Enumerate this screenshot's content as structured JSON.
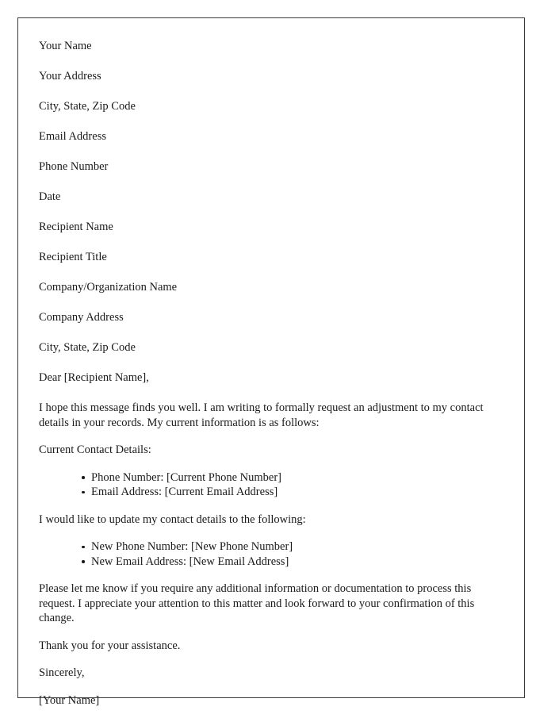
{
  "document": {
    "type": "formal-letter",
    "sender_block": [
      "Your Name",
      "Your Address",
      "City, State, Zip Code",
      "Email Address",
      "Phone Number"
    ],
    "date_line": "Date",
    "recipient_block": [
      "Recipient Name",
      "Recipient Title",
      "Company/Organization Name",
      "Company Address",
      "City, State, Zip Code"
    ],
    "salutation": "Dear [Recipient Name],",
    "opening_paragraph": "I hope this message finds you well. I am writing to formally request an adjustment to my contact details in your records. My current information is as follows:",
    "current_details_heading": "Current Contact Details:",
    "current_details_items": [
      "Phone Number: [Current Phone Number]",
      "Email Address: [Current Email Address]"
    ],
    "update_intro": "I would like to update my contact details to the following:",
    "new_details_items": [
      "New Phone Number: [New Phone Number]",
      "New Email Address: [New Email Address]"
    ],
    "closing_paragraph": "Please let me know if you require any additional information or documentation to process this request. I appreciate your attention to this matter and look forward to your confirmation of this change.",
    "thanks_line": "Thank you for your assistance.",
    "valediction": "Sincerely,",
    "signature_line": "[Your Name]"
  },
  "style": {
    "text_color": "#1a1a1a",
    "border_color": "#3a3a3a",
    "page_background": "#ffffff"
  }
}
